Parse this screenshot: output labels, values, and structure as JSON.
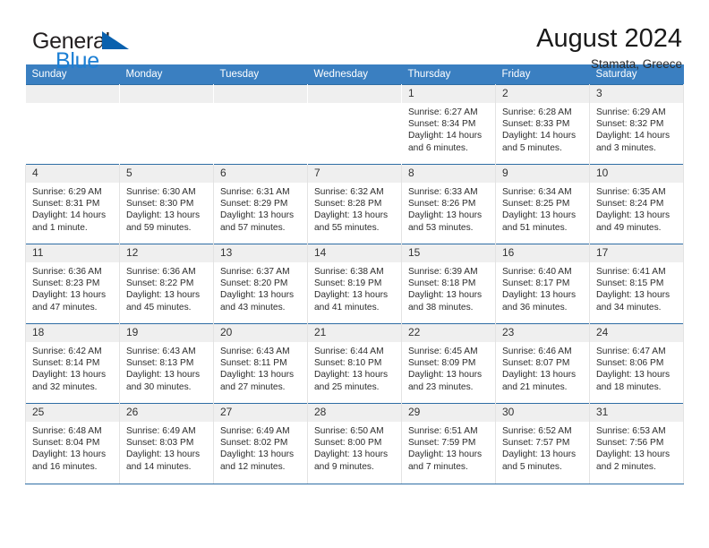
{
  "brand": {
    "name_part1": "General",
    "name_part2": "Blue",
    "logo_icon": "triangle-logo-icon",
    "accent_color": "#1c7fd4",
    "triangle_color": "#0a61ae"
  },
  "header": {
    "title": "August 2024",
    "subtitle": "Stamata, Greece"
  },
  "theme": {
    "header_row_color": "#3a7fc1",
    "row_divider_color": "#2e6da4",
    "daynum_band_color": "#efefef"
  },
  "calendar": {
    "weekdays": [
      "Sunday",
      "Monday",
      "Tuesday",
      "Wednesday",
      "Thursday",
      "Friday",
      "Saturday"
    ],
    "weeks": [
      [
        {
          "day": "",
          "sunrise": "",
          "sunset": "",
          "daylight_line1": "",
          "daylight_line2": "",
          "empty": true
        },
        {
          "day": "",
          "sunrise": "",
          "sunset": "",
          "daylight_line1": "",
          "daylight_line2": "",
          "empty": true
        },
        {
          "day": "",
          "sunrise": "",
          "sunset": "",
          "daylight_line1": "",
          "daylight_line2": "",
          "empty": true
        },
        {
          "day": "",
          "sunrise": "",
          "sunset": "",
          "daylight_line1": "",
          "daylight_line2": "",
          "empty": true
        },
        {
          "day": "1",
          "sunrise": "Sunrise: 6:27 AM",
          "sunset": "Sunset: 8:34 PM",
          "daylight_line1": "Daylight: 14 hours",
          "daylight_line2": "and 6 minutes.",
          "empty": false
        },
        {
          "day": "2",
          "sunrise": "Sunrise: 6:28 AM",
          "sunset": "Sunset: 8:33 PM",
          "daylight_line1": "Daylight: 14 hours",
          "daylight_line2": "and 5 minutes.",
          "empty": false
        },
        {
          "day": "3",
          "sunrise": "Sunrise: 6:29 AM",
          "sunset": "Sunset: 8:32 PM",
          "daylight_line1": "Daylight: 14 hours",
          "daylight_line2": "and 3 minutes.",
          "empty": false
        }
      ],
      [
        {
          "day": "4",
          "sunrise": "Sunrise: 6:29 AM",
          "sunset": "Sunset: 8:31 PM",
          "daylight_line1": "Daylight: 14 hours",
          "daylight_line2": "and 1 minute.",
          "empty": false
        },
        {
          "day": "5",
          "sunrise": "Sunrise: 6:30 AM",
          "sunset": "Sunset: 8:30 PM",
          "daylight_line1": "Daylight: 13 hours",
          "daylight_line2": "and 59 minutes.",
          "empty": false
        },
        {
          "day": "6",
          "sunrise": "Sunrise: 6:31 AM",
          "sunset": "Sunset: 8:29 PM",
          "daylight_line1": "Daylight: 13 hours",
          "daylight_line2": "and 57 minutes.",
          "empty": false
        },
        {
          "day": "7",
          "sunrise": "Sunrise: 6:32 AM",
          "sunset": "Sunset: 8:28 PM",
          "daylight_line1": "Daylight: 13 hours",
          "daylight_line2": "and 55 minutes.",
          "empty": false
        },
        {
          "day": "8",
          "sunrise": "Sunrise: 6:33 AM",
          "sunset": "Sunset: 8:26 PM",
          "daylight_line1": "Daylight: 13 hours",
          "daylight_line2": "and 53 minutes.",
          "empty": false
        },
        {
          "day": "9",
          "sunrise": "Sunrise: 6:34 AM",
          "sunset": "Sunset: 8:25 PM",
          "daylight_line1": "Daylight: 13 hours",
          "daylight_line2": "and 51 minutes.",
          "empty": false
        },
        {
          "day": "10",
          "sunrise": "Sunrise: 6:35 AM",
          "sunset": "Sunset: 8:24 PM",
          "daylight_line1": "Daylight: 13 hours",
          "daylight_line2": "and 49 minutes.",
          "empty": false
        }
      ],
      [
        {
          "day": "11",
          "sunrise": "Sunrise: 6:36 AM",
          "sunset": "Sunset: 8:23 PM",
          "daylight_line1": "Daylight: 13 hours",
          "daylight_line2": "and 47 minutes.",
          "empty": false
        },
        {
          "day": "12",
          "sunrise": "Sunrise: 6:36 AM",
          "sunset": "Sunset: 8:22 PM",
          "daylight_line1": "Daylight: 13 hours",
          "daylight_line2": "and 45 minutes.",
          "empty": false
        },
        {
          "day": "13",
          "sunrise": "Sunrise: 6:37 AM",
          "sunset": "Sunset: 8:20 PM",
          "daylight_line1": "Daylight: 13 hours",
          "daylight_line2": "and 43 minutes.",
          "empty": false
        },
        {
          "day": "14",
          "sunrise": "Sunrise: 6:38 AM",
          "sunset": "Sunset: 8:19 PM",
          "daylight_line1": "Daylight: 13 hours",
          "daylight_line2": "and 41 minutes.",
          "empty": false
        },
        {
          "day": "15",
          "sunrise": "Sunrise: 6:39 AM",
          "sunset": "Sunset: 8:18 PM",
          "daylight_line1": "Daylight: 13 hours",
          "daylight_line2": "and 38 minutes.",
          "empty": false
        },
        {
          "day": "16",
          "sunrise": "Sunrise: 6:40 AM",
          "sunset": "Sunset: 8:17 PM",
          "daylight_line1": "Daylight: 13 hours",
          "daylight_line2": "and 36 minutes.",
          "empty": false
        },
        {
          "day": "17",
          "sunrise": "Sunrise: 6:41 AM",
          "sunset": "Sunset: 8:15 PM",
          "daylight_line1": "Daylight: 13 hours",
          "daylight_line2": "and 34 minutes.",
          "empty": false
        }
      ],
      [
        {
          "day": "18",
          "sunrise": "Sunrise: 6:42 AM",
          "sunset": "Sunset: 8:14 PM",
          "daylight_line1": "Daylight: 13 hours",
          "daylight_line2": "and 32 minutes.",
          "empty": false
        },
        {
          "day": "19",
          "sunrise": "Sunrise: 6:43 AM",
          "sunset": "Sunset: 8:13 PM",
          "daylight_line1": "Daylight: 13 hours",
          "daylight_line2": "and 30 minutes.",
          "empty": false
        },
        {
          "day": "20",
          "sunrise": "Sunrise: 6:43 AM",
          "sunset": "Sunset: 8:11 PM",
          "daylight_line1": "Daylight: 13 hours",
          "daylight_line2": "and 27 minutes.",
          "empty": false
        },
        {
          "day": "21",
          "sunrise": "Sunrise: 6:44 AM",
          "sunset": "Sunset: 8:10 PM",
          "daylight_line1": "Daylight: 13 hours",
          "daylight_line2": "and 25 minutes.",
          "empty": false
        },
        {
          "day": "22",
          "sunrise": "Sunrise: 6:45 AM",
          "sunset": "Sunset: 8:09 PM",
          "daylight_line1": "Daylight: 13 hours",
          "daylight_line2": "and 23 minutes.",
          "empty": false
        },
        {
          "day": "23",
          "sunrise": "Sunrise: 6:46 AM",
          "sunset": "Sunset: 8:07 PM",
          "daylight_line1": "Daylight: 13 hours",
          "daylight_line2": "and 21 minutes.",
          "empty": false
        },
        {
          "day": "24",
          "sunrise": "Sunrise: 6:47 AM",
          "sunset": "Sunset: 8:06 PM",
          "daylight_line1": "Daylight: 13 hours",
          "daylight_line2": "and 18 minutes.",
          "empty": false
        }
      ],
      [
        {
          "day": "25",
          "sunrise": "Sunrise: 6:48 AM",
          "sunset": "Sunset: 8:04 PM",
          "daylight_line1": "Daylight: 13 hours",
          "daylight_line2": "and 16 minutes.",
          "empty": false
        },
        {
          "day": "26",
          "sunrise": "Sunrise: 6:49 AM",
          "sunset": "Sunset: 8:03 PM",
          "daylight_line1": "Daylight: 13 hours",
          "daylight_line2": "and 14 minutes.",
          "empty": false
        },
        {
          "day": "27",
          "sunrise": "Sunrise: 6:49 AM",
          "sunset": "Sunset: 8:02 PM",
          "daylight_line1": "Daylight: 13 hours",
          "daylight_line2": "and 12 minutes.",
          "empty": false
        },
        {
          "day": "28",
          "sunrise": "Sunrise: 6:50 AM",
          "sunset": "Sunset: 8:00 PM",
          "daylight_line1": "Daylight: 13 hours",
          "daylight_line2": "and 9 minutes.",
          "empty": false
        },
        {
          "day": "29",
          "sunrise": "Sunrise: 6:51 AM",
          "sunset": "Sunset: 7:59 PM",
          "daylight_line1": "Daylight: 13 hours",
          "daylight_line2": "and 7 minutes.",
          "empty": false
        },
        {
          "day": "30",
          "sunrise": "Sunrise: 6:52 AM",
          "sunset": "Sunset: 7:57 PM",
          "daylight_line1": "Daylight: 13 hours",
          "daylight_line2": "and 5 minutes.",
          "empty": false
        },
        {
          "day": "31",
          "sunrise": "Sunrise: 6:53 AM",
          "sunset": "Sunset: 7:56 PM",
          "daylight_line1": "Daylight: 13 hours",
          "daylight_line2": "and 2 minutes.",
          "empty": false
        }
      ]
    ]
  }
}
